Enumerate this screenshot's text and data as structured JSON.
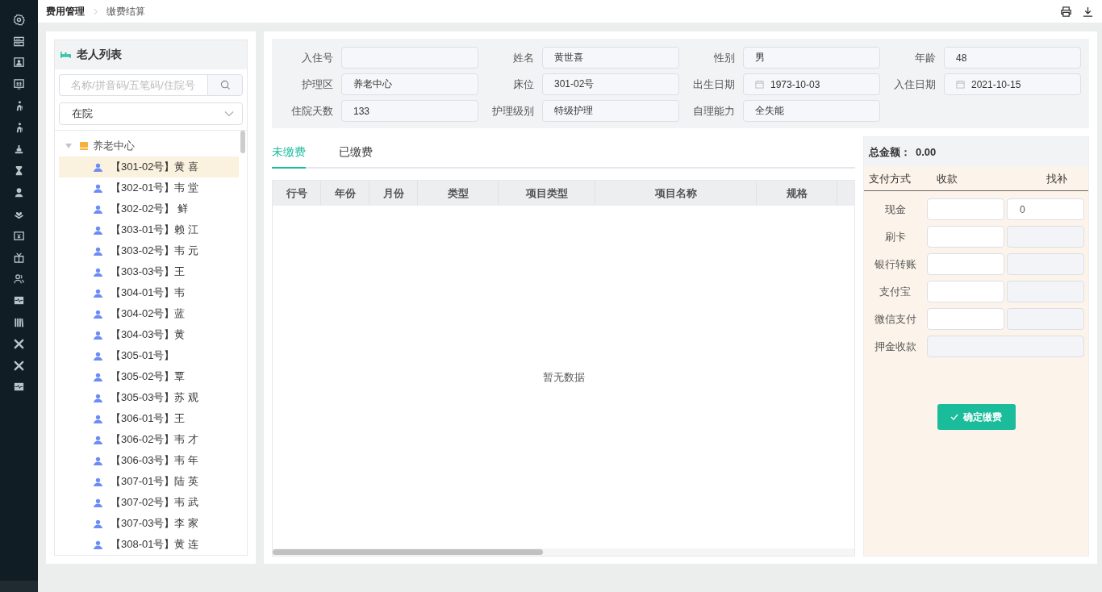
{
  "breadcrumb": [
    "费用管理",
    "缴费结算"
  ],
  "elder_panel": {
    "title": "老人列表",
    "search": {
      "placeholder": "名称/拼音码/五笔码/住院号"
    },
    "status_select": {
      "value": "在院"
    },
    "tree": {
      "label": "养老中心",
      "expanded": true,
      "children": [
        {
          "label": "【301-02号】黄 喜",
          "selected": true
        },
        {
          "label": "【302-01号】韦 堂",
          "selected": false
        },
        {
          "label": "【302-02号】 鲜",
          "selected": false
        },
        {
          "label": "【303-01号】赖 江",
          "selected": false
        },
        {
          "label": "【303-02号】韦 元",
          "selected": false
        },
        {
          "label": "【303-03号】王",
          "selected": false
        },
        {
          "label": "【304-01号】韦",
          "selected": false
        },
        {
          "label": "【304-02号】蓝",
          "selected": false
        },
        {
          "label": "【304-03号】黄",
          "selected": false
        },
        {
          "label": "【305-01号】",
          "selected": false
        },
        {
          "label": "【305-02号】覃",
          "selected": false
        },
        {
          "label": "【305-03号】苏 观",
          "selected": false
        },
        {
          "label": "【306-01号】王",
          "selected": false
        },
        {
          "label": "【306-02号】韦 才",
          "selected": false
        },
        {
          "label": "【306-03号】韦 年",
          "selected": false
        },
        {
          "label": "【307-01号】陆 英",
          "selected": false
        },
        {
          "label": "【307-02号】韦 武",
          "selected": false
        },
        {
          "label": "【307-03号】李 家",
          "selected": false
        },
        {
          "label": "【308-01号】黄 连",
          "selected": false
        }
      ]
    }
  },
  "info": [
    {
      "label": "入住号",
      "kind": "text"
    },
    {
      "label": "姓名",
      "kind": "text",
      "value": "黄世喜"
    },
    {
      "label": "性别",
      "kind": "text",
      "value": "男"
    },
    {
      "label": "年龄",
      "kind": "text",
      "value": "48"
    },
    {
      "label": "护理区",
      "kind": "text",
      "value": "养老中心"
    },
    {
      "label": "床位",
      "kind": "text",
      "value": "301-02号"
    },
    {
      "label": "出生日期",
      "kind": "date",
      "value": "1973-10-03"
    },
    {
      "label": "入住日期",
      "kind": "date",
      "value": "2021-10-15"
    },
    {
      "label": "住院天数",
      "kind": "text",
      "value": "133"
    },
    {
      "label": "护理级别",
      "kind": "text",
      "value": "特级护理"
    },
    {
      "label": "自理能力",
      "kind": "text",
      "value": "全失能"
    }
  ],
  "tabs": [
    {
      "label": "未缴费",
      "selected": true
    },
    {
      "label": "已缴费",
      "selected": false
    }
  ],
  "table": {
    "columns": [
      "行号",
      "年份",
      "月份",
      "类型",
      "项目类型",
      "项目名称",
      "规格"
    ],
    "empty_text": "暂无数据"
  },
  "payment": {
    "total_label": "总金额：",
    "total": "0.00",
    "columns": [
      "支付方式",
      "收款",
      "找补"
    ],
    "rows": [
      {
        "kind": "pair",
        "label": "现金",
        "change": "0",
        "change_disabled": false
      },
      {
        "kind": "pair",
        "label": "刷卡",
        "change_disabled": true
      },
      {
        "kind": "pair",
        "label": "银行转账",
        "change_disabled": true
      },
      {
        "kind": "pair",
        "label": "支付宝",
        "change_disabled": true
      },
      {
        "kind": "pair",
        "label": "微信支付",
        "change_disabled": true
      },
      {
        "kind": "single",
        "label": "押金收款",
        "disabled": true
      }
    ],
    "confirm_button": "确定缴费"
  }
}
